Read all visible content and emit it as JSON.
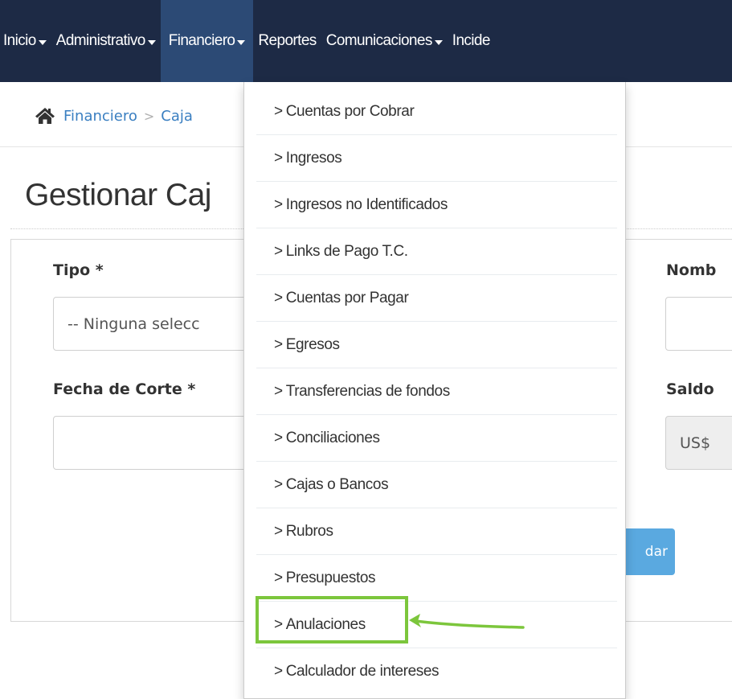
{
  "navbar": {
    "items": [
      {
        "label": "Inicio",
        "has_caret": true
      },
      {
        "label": "Administrativo",
        "has_caret": true
      },
      {
        "label": "Financiero",
        "has_caret": true,
        "active": true
      },
      {
        "label": "Reportes",
        "has_caret": false
      },
      {
        "label": "Comunicaciones",
        "has_caret": true
      },
      {
        "label": "Incide",
        "has_caret": false
      }
    ],
    "colors": {
      "background": "#1d2a45",
      "active": "#2c4a75"
    }
  },
  "breadcrumb": {
    "home_icon": "home-icon",
    "items": [
      {
        "label": "Financiero"
      },
      {
        "label": "Caja"
      }
    ],
    "separator": ">"
  },
  "page": {
    "title": "Gestionar Caj"
  },
  "form": {
    "tipo": {
      "label": "Tipo *",
      "value": "-- Ninguna selecc"
    },
    "nombre": {
      "label": "Nomb",
      "value": ""
    },
    "fecha_corte": {
      "label": "Fecha de Corte *",
      "value": ""
    },
    "saldo": {
      "label": "Saldo",
      "value": "US$"
    },
    "submit_label": "dar"
  },
  "dropdown": {
    "items": [
      {
        "label": "Cuentas por Cobrar"
      },
      {
        "label": "Ingresos"
      },
      {
        "label": "Ingresos no Identificados"
      },
      {
        "label": "Links de Pago T.C."
      },
      {
        "label": "Cuentas por Pagar"
      },
      {
        "label": "Egresos"
      },
      {
        "label": "Transferencias de fondos"
      },
      {
        "label": "Conciliaciones"
      },
      {
        "label": "Cajas o Bancos"
      },
      {
        "label": "Rubros"
      },
      {
        "label": "Presupuestos"
      },
      {
        "label": "Anulaciones",
        "highlighted": true
      },
      {
        "label": "Calculador de intereses"
      }
    ],
    "chevron": ">"
  },
  "annotation": {
    "color": "#7cc63c",
    "target": "Anulaciones"
  }
}
